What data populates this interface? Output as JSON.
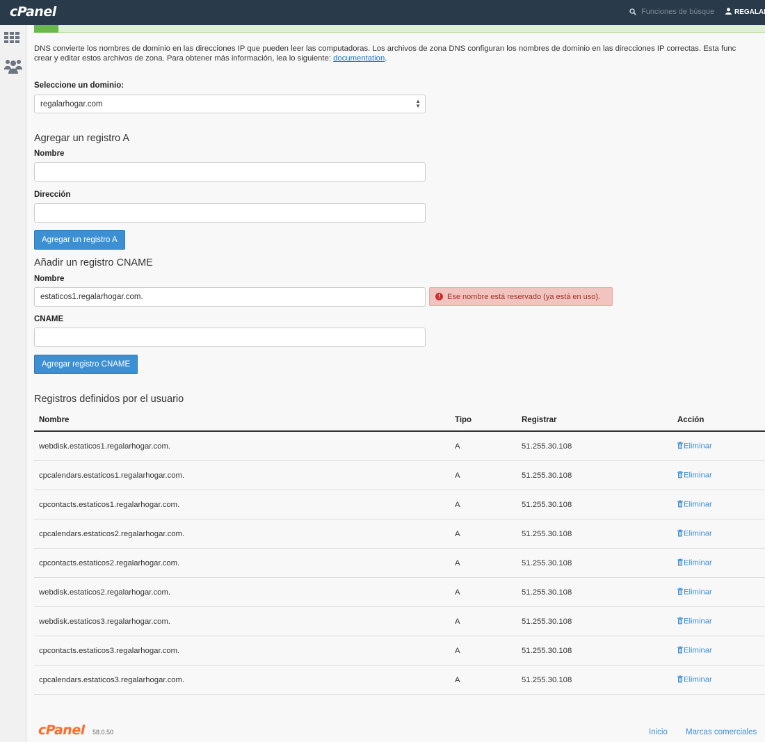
{
  "header": {
    "logo": "cPanel",
    "search_placeholder": "Funciones de búsque",
    "user": "REGALARI"
  },
  "intro": {
    "line1": "DNS convierte los nombres de dominio en las direcciones IP que pueden leer las computadoras. Los archivos de zona DNS configuran los nombres de dominio en las direcciones IP correctas. Esta func",
    "line2_prefix": "crear y editar estos archivos de zona. Para obtener más información, lea lo siguiente: ",
    "link": "documentation",
    "line2_suffix": "."
  },
  "domain_select": {
    "label": "Seleccione un dominio:",
    "value": "regalarhogar.com"
  },
  "a_record": {
    "title": "Agregar un registro A",
    "name_label": "Nombre",
    "name_value": "",
    "address_label": "Dirección",
    "address_value": "",
    "button": "Agregar un registro A"
  },
  "cname_record": {
    "title": "Añadir un registro CNAME",
    "name_label": "Nombre",
    "name_value": "estaticos1.regalarhogar.com.",
    "error": "Ese nombre está reservado (ya está en uso).",
    "cname_label": "CNAME",
    "cname_value": "",
    "button": "Agregar registro CNAME"
  },
  "records": {
    "title": "Registros definidos por el usuario",
    "headers": [
      "Nombre",
      "Tipo",
      "Registrar",
      "Acción"
    ],
    "rows": [
      {
        "name": "webdisk.estaticos1.regalarhogar.com.",
        "type": "A",
        "record": "51.255.30.108",
        "action": "Eliminar"
      },
      {
        "name": "cpcalendars.estaticos1.regalarhogar.com.",
        "type": "A",
        "record": "51.255.30.108",
        "action": "Eliminar"
      },
      {
        "name": "cpcontacts.estaticos1.regalarhogar.com.",
        "type": "A",
        "record": "51.255.30.108",
        "action": "Eliminar"
      },
      {
        "name": "cpcalendars.estaticos2.regalarhogar.com.",
        "type": "A",
        "record": "51.255.30.108",
        "action": "Eliminar"
      },
      {
        "name": "cpcontacts.estaticos2.regalarhogar.com.",
        "type": "A",
        "record": "51.255.30.108",
        "action": "Eliminar"
      },
      {
        "name": "webdisk.estaticos2.regalarhogar.com.",
        "type": "A",
        "record": "51.255.30.108",
        "action": "Eliminar"
      },
      {
        "name": "webdisk.estaticos3.regalarhogar.com.",
        "type": "A",
        "record": "51.255.30.108",
        "action": "Eliminar"
      },
      {
        "name": "cpcontacts.estaticos3.regalarhogar.com.",
        "type": "A",
        "record": "51.255.30.108",
        "action": "Eliminar"
      },
      {
        "name": "cpcalendars.estaticos3.regalarhogar.com.",
        "type": "A",
        "record": "51.255.30.108",
        "action": "Eliminar"
      }
    ]
  },
  "footer": {
    "logo": "cPanel",
    "version": "58.0.50",
    "home_link": "Inicio",
    "trademarks_link": "Marcas comerciales"
  },
  "colors": {
    "topbar": "#293a4a",
    "primary_button": "#3d8fd4",
    "error_bg": "#f2c4c0",
    "success_strip": "#dff0d8",
    "footer_logo": "#ff6c2c"
  },
  "icons": {
    "search": "search-icon",
    "user": "user-icon",
    "apps": "apps-grid-icon",
    "users": "users-group-icon",
    "error": "exclamation-circle-icon",
    "delete": "trash-icon",
    "select": "select-arrows-icon"
  }
}
